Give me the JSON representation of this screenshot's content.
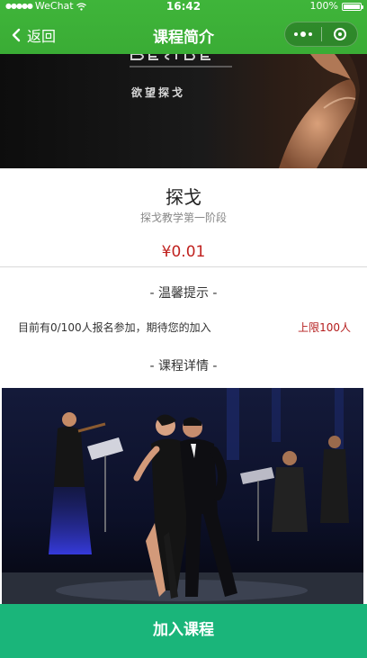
{
  "status_bar": {
    "carrier": "WeChat",
    "time": "16:42",
    "battery": "100%",
    "battery_level": 1.0
  },
  "nav": {
    "back_label": "返回",
    "title": "课程简介",
    "icons": [
      "chevron-left-icon",
      "more-dots-icon",
      "close-circle-icon"
    ]
  },
  "hero": {
    "caption": "欲望探戈"
  },
  "course": {
    "title": "探戈",
    "subtitle": "探戈教学第一阶段",
    "price": "¥0.01"
  },
  "tips": {
    "heading": "- 温馨提示 -",
    "enrollment_text": "目前有0/100人报名参加，期待您的加入",
    "limit_text": "上限100人"
  },
  "details": {
    "heading": "- 课程详情 -"
  },
  "action": {
    "join_label": "加入课程"
  },
  "colors": {
    "nav_green": "#3fb53a",
    "price_red": "#c0221f",
    "limit_red": "#b41c1c",
    "button_green": "#1ab57a"
  }
}
